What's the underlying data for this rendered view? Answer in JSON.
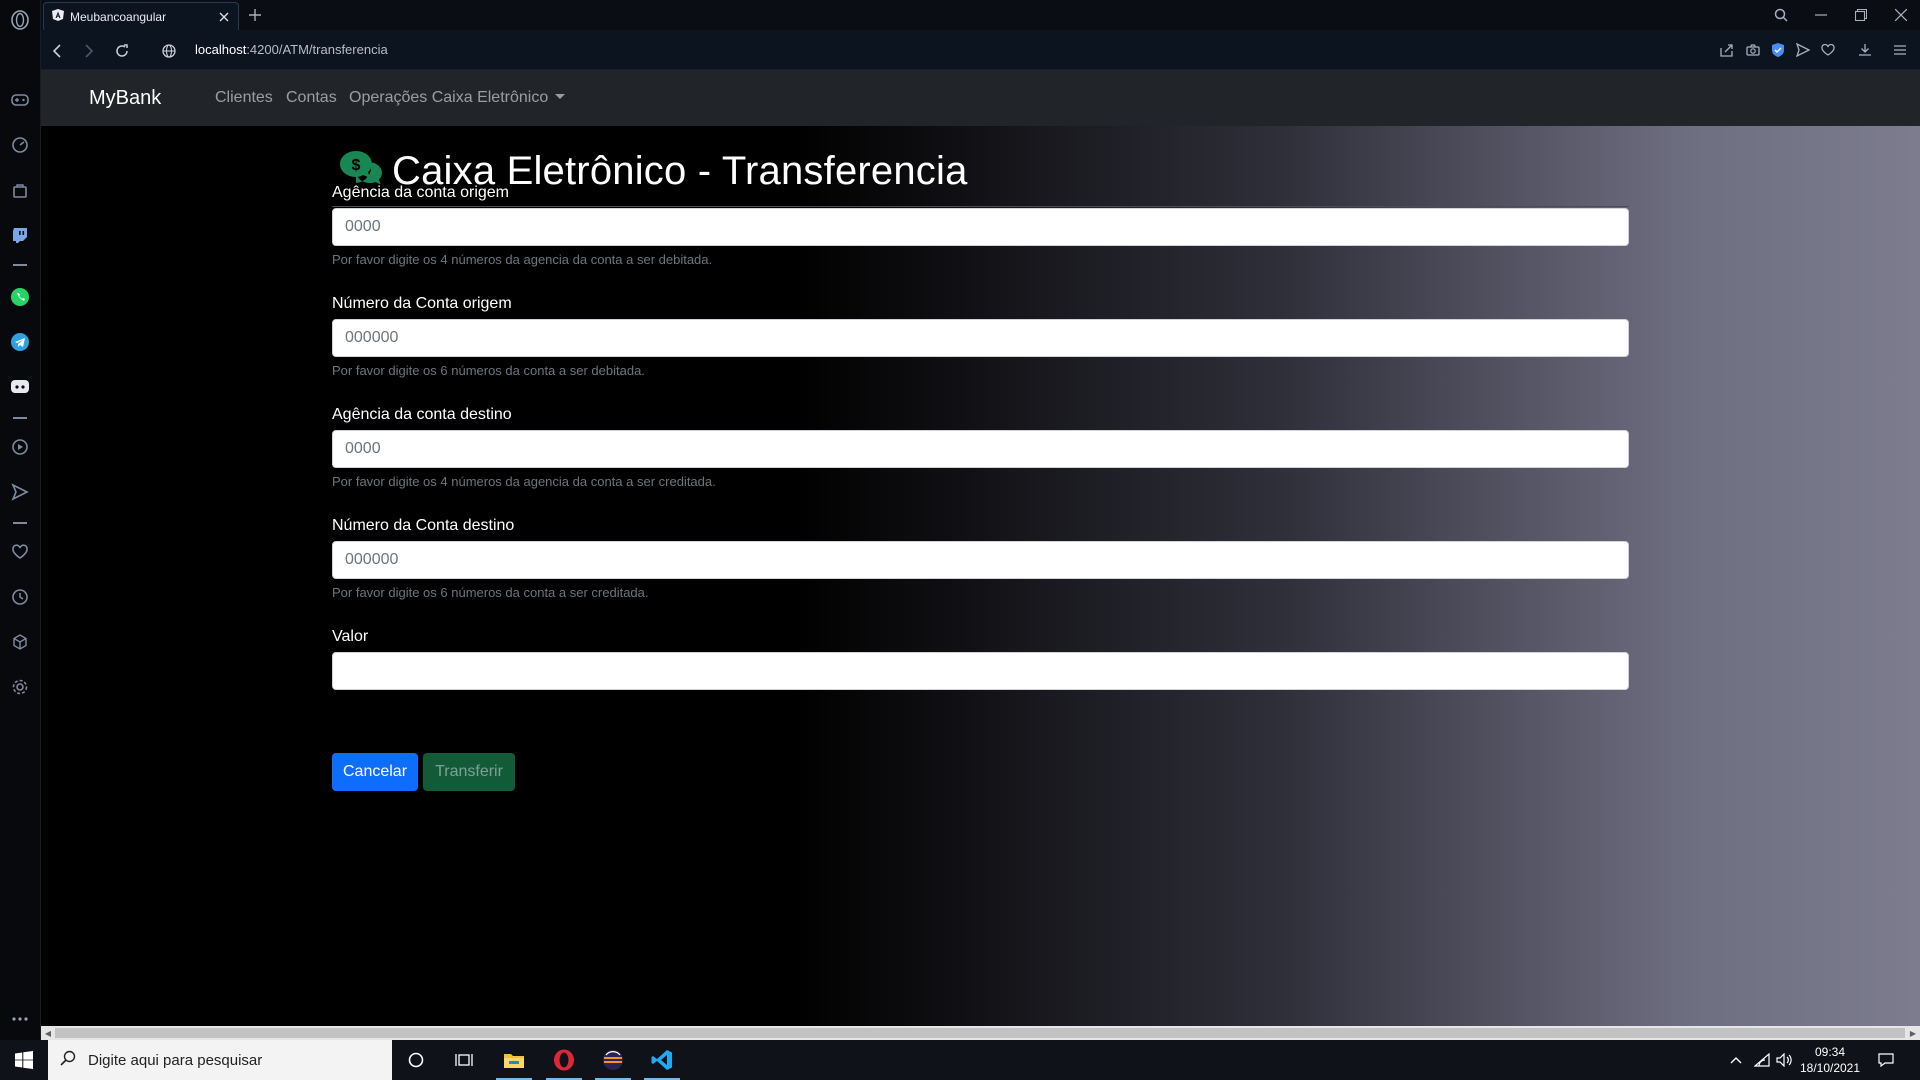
{
  "browser": {
    "tab_title": "Meubancoangular",
    "url_host": "localhost",
    "url_path": ":4200/ATM/transferencia"
  },
  "navbar": {
    "brand": "MyBank",
    "links": [
      "Clientes",
      "Contas",
      "Operações Caixa Eletrônico"
    ]
  },
  "page": {
    "title": "Caixa Eletrônico - Transferencia",
    "title_icon": "comments-dollar-icon"
  },
  "form": {
    "fields": [
      {
        "label": "Agência da conta origem",
        "placeholder": "0000",
        "help": "Por favor digite os 4 números da agencia da conta a ser debitada."
      },
      {
        "label": "Número da Conta origem",
        "placeholder": "000000",
        "help": "Por favor digite os 6 números da conta a ser debitada."
      },
      {
        "label": "Agência da conta destino",
        "placeholder": "0000",
        "help": "Por favor digite os 4 números da agencia da conta a ser creditada."
      },
      {
        "label": "Número da Conta destino",
        "placeholder": "000000",
        "help": "Por favor digite os 6 números da conta a ser creditada."
      },
      {
        "label": "Valor",
        "placeholder": ""
      }
    ],
    "cancel_label": "Cancelar",
    "submit_label": "Transferir"
  },
  "taskbar": {
    "search_placeholder": "Digite aqui para pesquisar",
    "time": "09:34",
    "date": "18/10/2021"
  },
  "colors": {
    "primary": "#0d6efd",
    "success": "#146c43",
    "navbar_bg": "#212529",
    "icon_green": "#198754"
  }
}
